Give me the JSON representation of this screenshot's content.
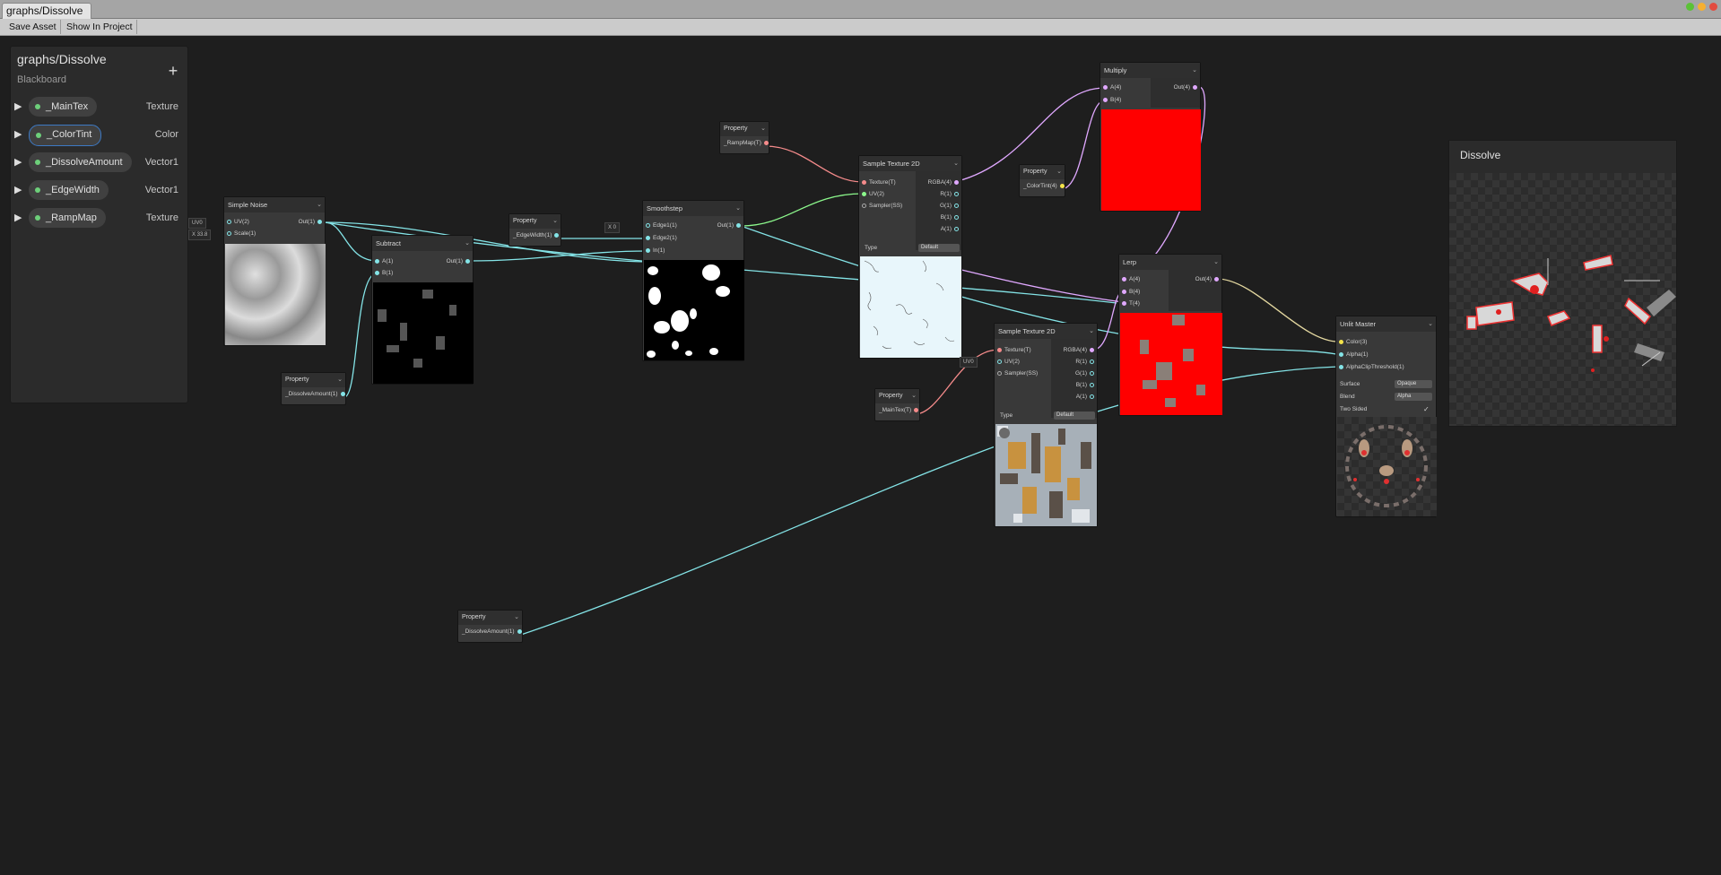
{
  "window": {
    "tab_title": "graphs/Dissolve"
  },
  "toolbar": {
    "save_asset": "Save Asset",
    "show_in_project": "Show In Project"
  },
  "blackboard": {
    "title": "graphs/Dissolve",
    "subtitle": "Blackboard",
    "add_label": "+",
    "properties": [
      {
        "name": "_MainTex",
        "type": "Texture"
      },
      {
        "name": "_ColorTint",
        "type": "Color"
      },
      {
        "name": "_DissolveAmount",
        "type": "Vector1"
      },
      {
        "name": "_EdgeWidth",
        "type": "Vector1"
      },
      {
        "name": "_RampMap",
        "type": "Texture"
      }
    ]
  },
  "nodes": {
    "simple_noise": {
      "title": "Simple Noise",
      "in1": "UV(2)",
      "in2": "Scale(1)",
      "out": "Out(1)",
      "uv_default": "UV0",
      "scale_default": "X 33.8"
    },
    "subtract": {
      "title": "Subtract",
      "in1": "A(1)",
      "in2": "B(1)",
      "out": "Out(1)"
    },
    "smoothstep": {
      "title": "Smoothstep",
      "in1": "Edge1(1)",
      "in2": "Edge2(1)",
      "in3": "In(1)",
      "out": "Out(1)",
      "edge1_default": "X 0"
    },
    "sample1": {
      "title": "Sample Texture 2D",
      "in1": "Texture(T)",
      "in2": "UV(2)",
      "in3": "Sampler(SS)",
      "o1": "RGBA(4)",
      "o2": "R(1)",
      "o3": "G(1)",
      "o4": "B(1)",
      "o5": "A(1)",
      "type_label": "Type",
      "type_value": "Default"
    },
    "sample2": {
      "title": "Sample Texture 2D",
      "in1": "Texture(T)",
      "in2": "UV(2)",
      "in3": "Sampler(SS)",
      "o1": "RGBA(4)",
      "o2": "R(1)",
      "o3": "G(1)",
      "o4": "B(1)",
      "o5": "A(1)",
      "type_label": "Type",
      "type_value": "Default",
      "uv_default": "UV0"
    },
    "multiply": {
      "title": "Multiply",
      "in1": "A(4)",
      "in2": "B(4)",
      "out": "Out(4)"
    },
    "lerp": {
      "title": "Lerp",
      "in1": "A(4)",
      "in2": "B(4)",
      "in3": "T(4)",
      "out": "Out(4)"
    },
    "unlit_master": {
      "title": "Unlit Master",
      "in1": "Color(3)",
      "in2": "Alpha(1)",
      "in3": "AlphaClipThreshold(1)",
      "surface_label": "Surface",
      "surface_value": "Opaque",
      "blend_label": "Blend",
      "blend_value": "Alpha",
      "two_sided_label": "Two Sided",
      "two_sided_check": "✓"
    }
  },
  "properties_nodes": {
    "header": "Property",
    "p_rampmap": "_RampMap(T)",
    "p_edgewidth": "_EdgeWidth(1)",
    "p_dissolve1": "_DissolveAmount(1)",
    "p_colortint": "_ColorTint(4)",
    "p_maintex": "_MainTex(T)",
    "p_dissolve2": "_DissolveAmount(1)"
  },
  "main_preview": {
    "title": "Dissolve"
  },
  "colors": {
    "float_port": "#84e4e7",
    "texture_port": "#f58b8b",
    "vector4_port": "#e0a8ff",
    "color_port": "#f4e34b",
    "uv_port": "#8cf88c",
    "red_preview": "#ff0000"
  }
}
